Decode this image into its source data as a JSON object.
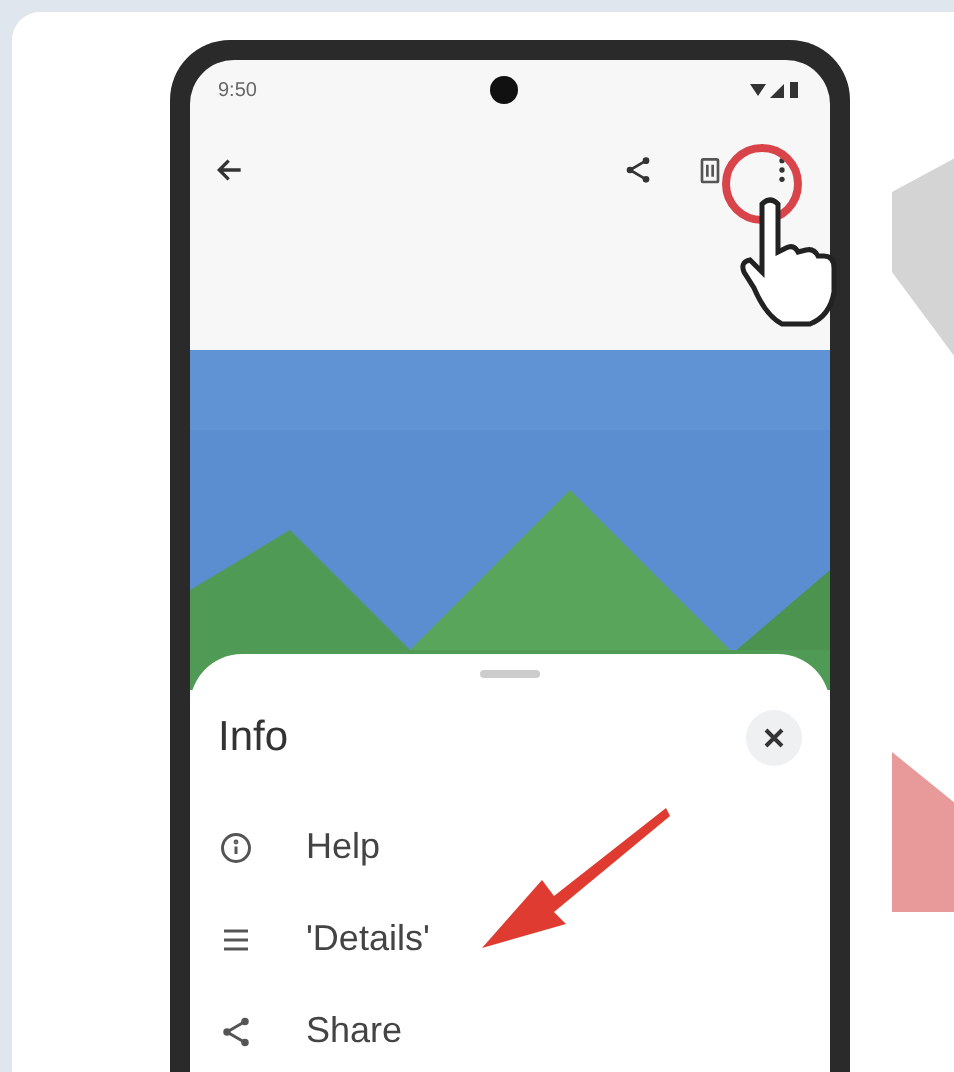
{
  "status_bar": {
    "time": "9:50"
  },
  "sheet": {
    "title": "Info",
    "items": [
      {
        "kind": "info",
        "label": "Help"
      },
      {
        "kind": "list",
        "label": "'Details'"
      },
      {
        "kind": "share",
        "label": "Share"
      }
    ]
  }
}
